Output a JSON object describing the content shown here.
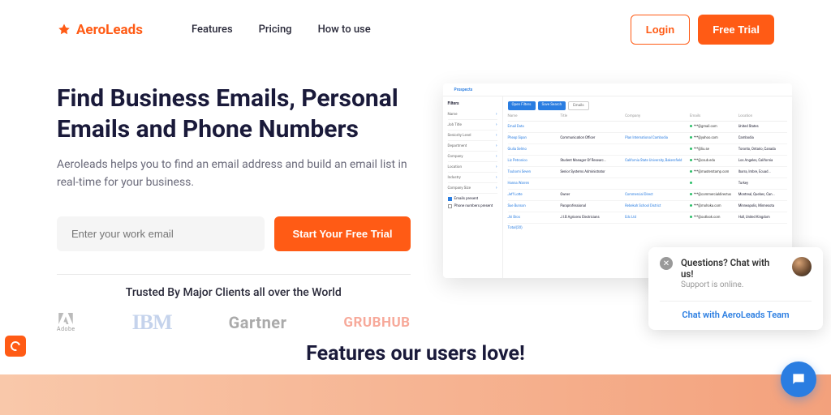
{
  "brand": {
    "name": "AeroLeads",
    "accent": "#ff5b15"
  },
  "nav": {
    "items": [
      "Features",
      "Pricing",
      "How to use"
    ]
  },
  "header": {
    "login": "Login",
    "free_trial": "Free Trial"
  },
  "hero": {
    "title": "Find Business Emails, Personal Emails and Phone Numbers",
    "subtitle": "Aeroleads helps you to find an email address and build an email list in real-time for your business.",
    "email_placeholder": "Enter your work email",
    "cta": "Start Your Free Trial"
  },
  "trusted": {
    "title": "Trusted By Major Clients all over the World",
    "clients": [
      "Adobe",
      "IBM",
      "Gartner",
      "GRUBHUB"
    ]
  },
  "features": {
    "title": "Features our users love!"
  },
  "chat": {
    "title": "Questions? Chat with us!",
    "subtitle": "Support is online.",
    "link": "Chat with AeroLeads Team"
  },
  "mock": {
    "tab": "Prospects",
    "filters_label": "Filters",
    "filters": [
      "Name",
      "Job Title",
      "Seniority Level",
      "Department",
      "Company",
      "Location",
      "Industry",
      "Company Size"
    ],
    "checkboxes": {
      "emails": "Emails present",
      "phones": "Phone numbers present"
    },
    "pills": [
      "Open Filters",
      "Save Search"
    ],
    "select": "Emails",
    "columns": [
      "Name",
      "Title",
      "Company",
      "Emails",
      "Location"
    ],
    "rows": [
      {
        "name": "Email Data",
        "title": "",
        "company": "",
        "email": "***@gmail.com",
        "loc": "United States"
      },
      {
        "name": "Pheap Sipan",
        "title": "Communication Officer",
        "company": "Plan International Cambodia",
        "email": "***@yahoo.com",
        "loc": "Cambodia"
      },
      {
        "name": "Giulia Selmo",
        "title": "",
        "company": "",
        "email": "***@liu.se",
        "loc": "Toronto, Ontario, Canada"
      },
      {
        "name": "Liz Petronico",
        "title": "Student Manager Of Researc...",
        "company": "California State University, Bakersfield",
        "email": "***@csub.edu",
        "loc": "Los Angeles, California"
      },
      {
        "name": "Tsubomi Seven",
        "title": "Senior Systems Administrator",
        "company": "",
        "email": "***@masterstamp.com",
        "loc": "Ibarra, Imbre, Ecuad..."
      },
      {
        "name": "Hanna Warren",
        "title": "",
        "company": "",
        "email": "",
        "loc": "Turkey"
      },
      {
        "name": "Jeff Lotte",
        "title": "Owner",
        "company": "Commercial Direct",
        "email": "***@commercialdirectus",
        "loc": "Montreal, Quebec, Can..."
      },
      {
        "name": "Sue Bunson",
        "title": "Paraprofessional",
        "company": "Rebekah School District",
        "email": "***@mohoka.com",
        "loc": "Minneapolis, Minnesota"
      },
      {
        "name": "Jiri Bros",
        "title": "J.I.B Agricens Electricians",
        "company": "Edc Ltd",
        "email": "***@outlook.com",
        "loc": "Hull, United Kingdom"
      }
    ],
    "total": "Total(20)"
  }
}
